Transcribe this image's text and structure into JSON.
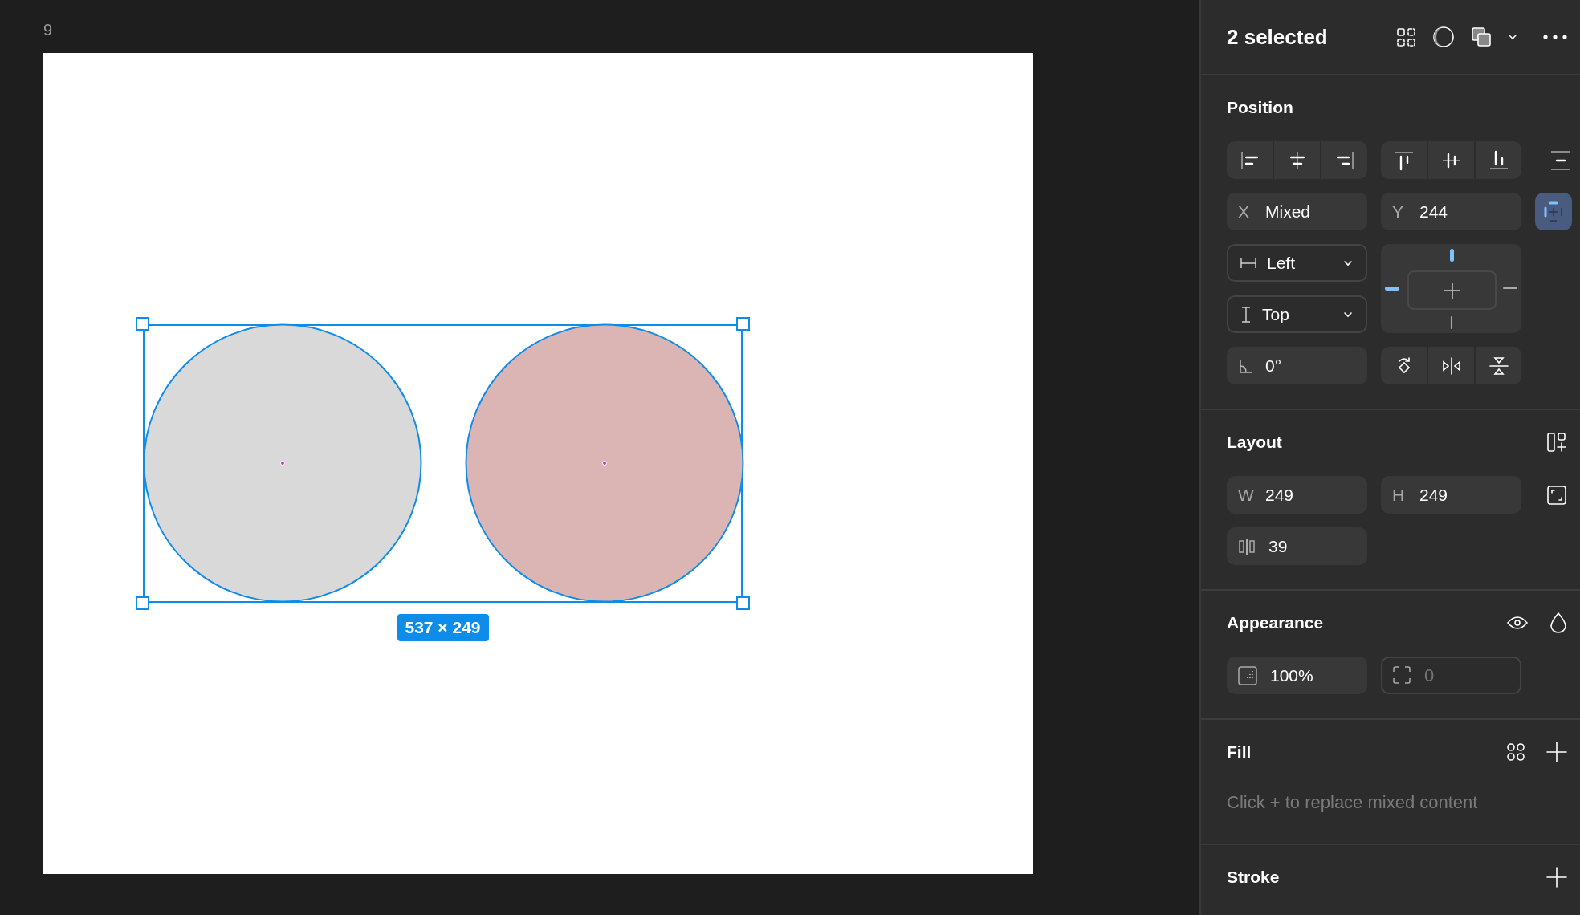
{
  "canvas": {
    "frame_label": "9",
    "shapes": [
      {
        "kind": "ellipse",
        "color": "#d9d9d9"
      },
      {
        "kind": "ellipse",
        "color": "#dbb4b4"
      }
    ],
    "selection": {
      "size_label": "537 × 249"
    }
  },
  "panel": {
    "title": "2 selected",
    "position": {
      "title": "Position",
      "x": {
        "label": "X",
        "value": "Mixed"
      },
      "y": {
        "label": "Y",
        "value": "244"
      },
      "constraint_toggle": {
        "on": true
      },
      "horizontal": {
        "value": "Left"
      },
      "vertical": {
        "value": "Top"
      },
      "rotation": {
        "value": "0°"
      }
    },
    "layout": {
      "title": "Layout",
      "width": {
        "label": "W",
        "value": "249"
      },
      "height": {
        "label": "H",
        "value": "249"
      },
      "gap": {
        "value": "39"
      }
    },
    "appearance": {
      "title": "Appearance",
      "opacity": {
        "value": "100%"
      },
      "radius": {
        "placeholder": "0"
      }
    },
    "fill": {
      "title": "Fill",
      "message": "Click + to replace mixed content"
    },
    "stroke": {
      "title": "Stroke"
    }
  }
}
